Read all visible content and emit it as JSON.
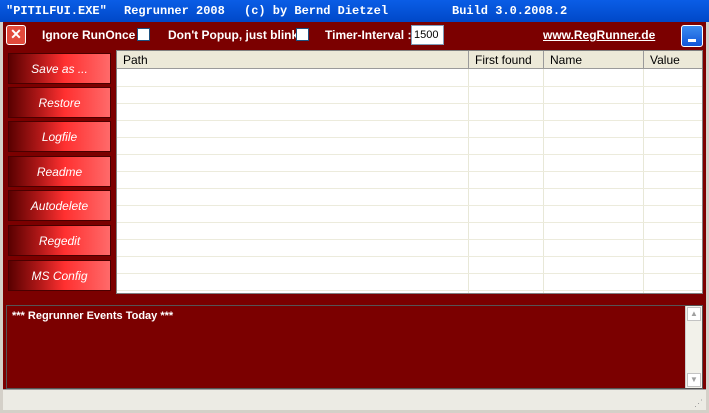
{
  "titlebar": {
    "app": "\"PITILFUI.EXE\"",
    "name": "Regrunner 2008",
    "copyright": "(c) by Bernd Dietzel",
    "build": "Build 3.0.2008.2"
  },
  "topbar": {
    "ignore_runonce_label": "Ignore RunOnce",
    "dont_popup_label": "Don't Popup, just blink",
    "timer_label": "Timer-Interval :",
    "timer_value": "1500",
    "link": "www.RegRunner.de"
  },
  "side_buttons": [
    "Save as ...",
    "Restore",
    "Logfile",
    "Readme",
    "Autodelete",
    "Regedit",
    "MS Config"
  ],
  "grid": {
    "columns": [
      "Path",
      "First found",
      "Name",
      "Value"
    ]
  },
  "events": {
    "text": "*** Regrunner Events Today ***"
  },
  "colors": {
    "frame": "#7b0000",
    "titlebar": "#0a5de6",
    "button_gradient_end": "#ff6a6a"
  }
}
